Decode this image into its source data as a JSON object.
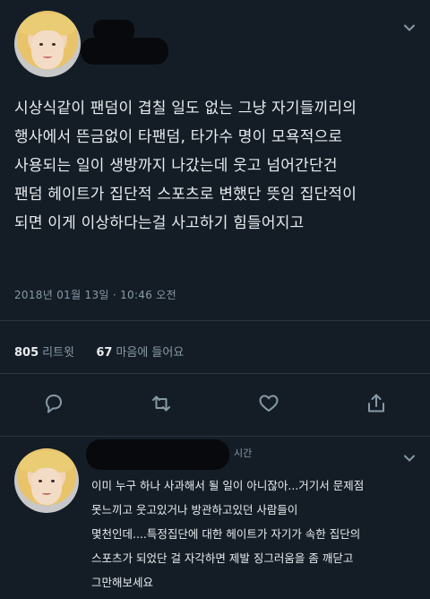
{
  "tweet": {
    "lines": [
      "시상식같이 팬덤이 겹칠 일도 없는 그냥 자기들끼리의",
      "행사에서 뜬금없이 타팬덤, 타가수 명이 모욕적으로",
      "사용되는 일이 생방까지 나갔는데 웃고 넘어간단건",
      "팬덤 헤이트가 집단적 스포츠로 변했단 뜻임 집단적이",
      "되면 이게 이상하다는걸 사고하기 힘들어지고"
    ],
    "timestamp": "2018년 01월 13일 · 10:46 오전"
  },
  "stats": {
    "retweets_count": "805",
    "retweets_label": "리트윗",
    "likes_count": "67",
    "likes_label": "마음에 들어요"
  },
  "icons": {
    "reply": "reply-icon",
    "retweet": "retweet-icon",
    "like": "heart-icon",
    "share": "share-icon",
    "more": "chevron-down-icon"
  },
  "reply": {
    "time_label": "시간",
    "lines": [
      "이미 누구 하나 사과해서 될 일이 아니잖아...거기서 문제점",
      "못느끼고 웃고있거나 방관하고있던 사람들이",
      "몇천인데....특정집단에 대한 헤이트가 자기가 속한 집단의",
      "스포츠가 되었단 걸 자각하면 제발 징그러움을 좀 깨닫고",
      "그만해보세요"
    ]
  },
  "colors": {
    "background": "#141d26",
    "text": "#e8ecef",
    "muted": "#8899a6",
    "divider": "#2a3642"
  }
}
